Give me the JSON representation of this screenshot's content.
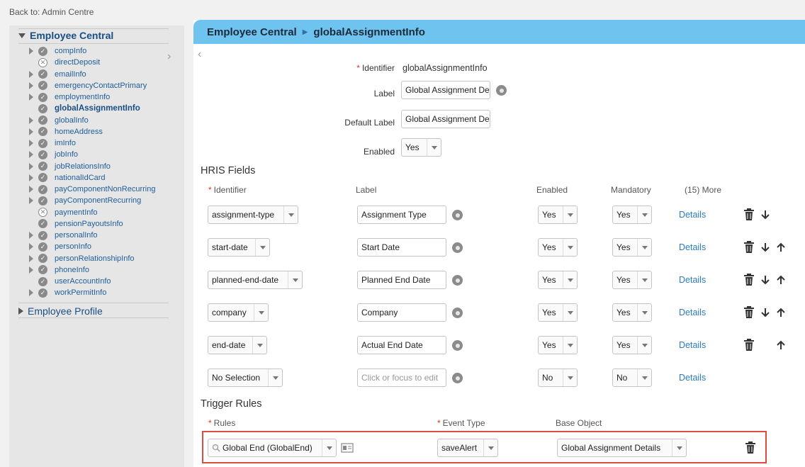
{
  "back_link": "Back to: Admin Centre",
  "sidebar": {
    "root_open": "Employee Central",
    "root_closed": "Employee Profile",
    "items": [
      {
        "label": "compInfo",
        "expand": true,
        "status": "ok"
      },
      {
        "label": "directDeposit",
        "expand": false,
        "status": "x"
      },
      {
        "label": "emailInfo",
        "expand": true,
        "status": "ok"
      },
      {
        "label": "emergencyContactPrimary",
        "expand": true,
        "status": "ok"
      },
      {
        "label": "employmentInfo",
        "expand": true,
        "status": "ok"
      },
      {
        "label": "globalAssignmentInfo",
        "expand": false,
        "status": "ok",
        "selected": true
      },
      {
        "label": "globalInfo",
        "expand": true,
        "status": "ok"
      },
      {
        "label": "homeAddress",
        "expand": true,
        "status": "ok"
      },
      {
        "label": "imInfo",
        "expand": true,
        "status": "ok"
      },
      {
        "label": "jobInfo",
        "expand": true,
        "status": "ok"
      },
      {
        "label": "jobRelationsInfo",
        "expand": true,
        "status": "ok"
      },
      {
        "label": "nationalIdCard",
        "expand": true,
        "status": "ok"
      },
      {
        "label": "payComponentNonRecurring",
        "expand": true,
        "status": "ok"
      },
      {
        "label": "payComponentRecurring",
        "expand": true,
        "status": "ok"
      },
      {
        "label": "paymentInfo",
        "expand": false,
        "status": "x"
      },
      {
        "label": "pensionPayoutsInfo",
        "expand": false,
        "status": "ok"
      },
      {
        "label": "personalInfo",
        "expand": true,
        "status": "ok"
      },
      {
        "label": "personInfo",
        "expand": true,
        "status": "ok"
      },
      {
        "label": "personRelationshipInfo",
        "expand": true,
        "status": "ok"
      },
      {
        "label": "phoneInfo",
        "expand": true,
        "status": "ok"
      },
      {
        "label": "userAccountInfo",
        "expand": false,
        "status": "ok"
      },
      {
        "label": "workPermitInfo",
        "expand": true,
        "status": "ok"
      }
    ]
  },
  "header": {
    "crumb1": "Employee Central",
    "crumb2": "globalAssignmentInfo"
  },
  "form": {
    "identifier_label": "Identifier",
    "identifier_value": "globalAssignmentInfo",
    "label_label": "Label",
    "label_value": "Global Assignment De",
    "default_label_label": "Default Label",
    "default_label_value": "Global Assignment De",
    "enabled_label": "Enabled",
    "enabled_value": "Yes"
  },
  "hris": {
    "title": "HRIS Fields",
    "col_identifier": "Identifier",
    "col_label": "Label",
    "col_enabled": "Enabled",
    "col_mandatory": "Mandatory",
    "col_more": "(15) More",
    "details": "Details",
    "rows": [
      {
        "identifier": "assignment-type",
        "label": "Assignment Type",
        "enabled": "Yes",
        "mandatory": "Yes",
        "down": true,
        "up": false
      },
      {
        "identifier": "start-date",
        "label": "Start Date",
        "enabled": "Yes",
        "mandatory": "Yes",
        "down": true,
        "up": true
      },
      {
        "identifier": "planned-end-date",
        "label": "Planned End Date",
        "enabled": "Yes",
        "mandatory": "Yes",
        "down": true,
        "up": true
      },
      {
        "identifier": "company",
        "label": "Company",
        "enabled": "Yes",
        "mandatory": "Yes",
        "down": true,
        "up": true
      },
      {
        "identifier": "end-date",
        "label": "Actual End Date",
        "enabled": "Yes",
        "mandatory": "Yes",
        "down": false,
        "up": true
      },
      {
        "identifier": "No Selection",
        "label": "",
        "placeholder": "Click or focus to edit",
        "enabled": "No",
        "mandatory": "No",
        "new": true
      }
    ]
  },
  "trigger": {
    "title": "Trigger Rules",
    "col_rules": "Rules",
    "col_event": "Event Type",
    "col_base": "Base Object",
    "rule_value": "Global End (GlobalEnd)",
    "event_value": "saveAlert",
    "base_value": "Global Assignment Details"
  }
}
